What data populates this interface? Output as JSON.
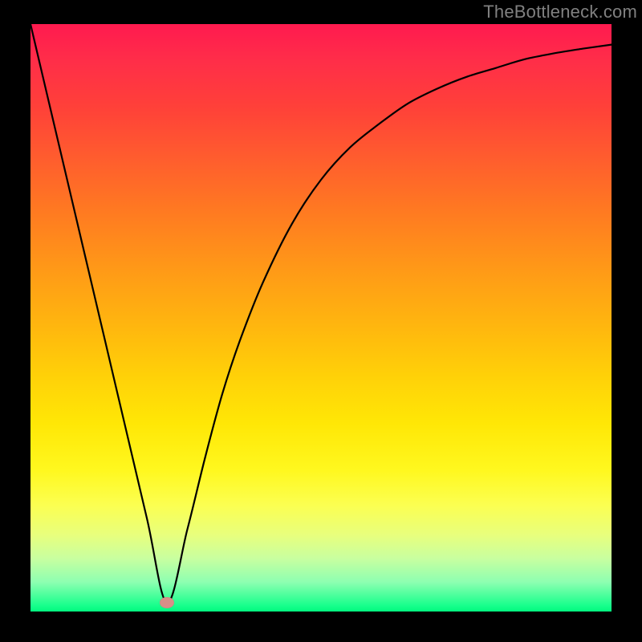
{
  "watermark": "TheBottleneck.com",
  "colors": {
    "frame_bg": "#000000",
    "marker": "#d98f88",
    "curve": "#000000"
  },
  "chart_data": {
    "type": "line",
    "title": "",
    "xlabel": "",
    "ylabel": "",
    "xlim": [
      0,
      100
    ],
    "ylim": [
      0,
      100
    ],
    "series": [
      {
        "name": "bottleneck-curve",
        "x": [
          0,
          5,
          10,
          15,
          20,
          23.5,
          27,
          30,
          33,
          36,
          40,
          45,
          50,
          55,
          60,
          65,
          70,
          75,
          80,
          85,
          90,
          95,
          100
        ],
        "y": [
          100,
          79,
          58,
          37,
          16,
          1.5,
          14,
          26,
          37,
          46,
          56,
          66,
          73.5,
          79,
          83,
          86.5,
          89,
          91,
          92.5,
          94,
          95,
          95.8,
          96.5
        ]
      }
    ],
    "marker": {
      "x": 23.5,
      "y": 1.5
    },
    "gradient_stops": [
      {
        "pos": 0,
        "color": "#ff1a4f"
      },
      {
        "pos": 50,
        "color": "#ffb80e"
      },
      {
        "pos": 80,
        "color": "#fff81f"
      },
      {
        "pos": 100,
        "color": "#02f97f"
      }
    ]
  }
}
